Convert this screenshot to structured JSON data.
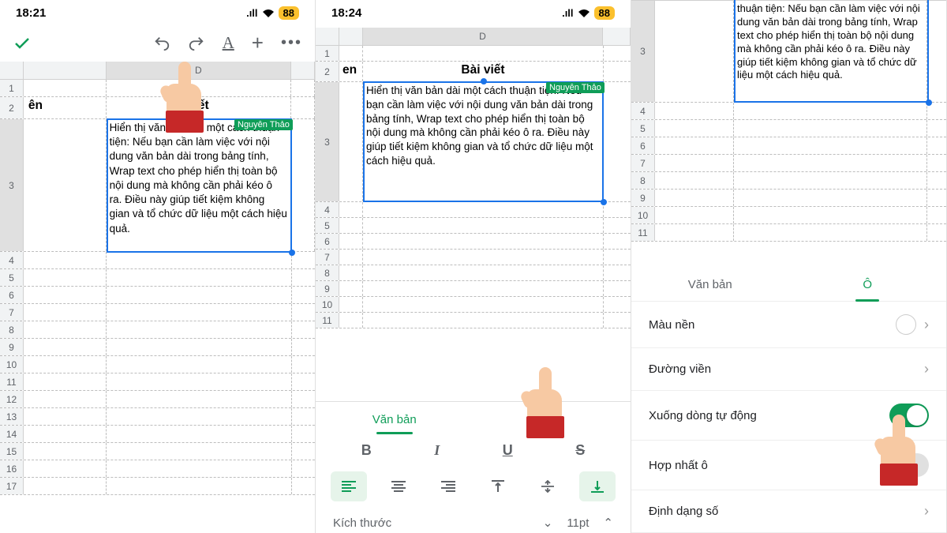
{
  "status": {
    "time1": "18:21",
    "time2": "18:24",
    "battery": "88",
    "signal": "••ıl",
    "wifi": "✓"
  },
  "toolbar": {
    "confirm": "✓",
    "undo": "↶",
    "redo": "↷",
    "format": "A",
    "add": "+",
    "more": "•••"
  },
  "sheet": {
    "columns": [
      "D"
    ],
    "row2_left": "ên",
    "row2_left_b": "en",
    "row2_title_a": "viết",
    "row2_title": "Bài viết",
    "cell_text_a": "Hiển thị\nthuận tiện: Nếu bạn cần làm việc với nội dung văn bản dài trong bảng tính, Wrap text cho phép hiển thị toàn bộ nội dung mà không cần phải kéo ô ra. Điều này giúp tiết kiệm không gian và tổ chức dữ liệu một cách hiệu quả.",
    "cell_text_a_frag": "ản dài mộ",
    "cell_text": "Hiển thị văn bản dài một cách thuận tiện: Nếu bạn cần làm việc với nội dung văn bản dài trong bảng tính, Wrap text cho phép hiển thị toàn bộ nội dung mà không cần phải kéo ô ra. Điều này giúp tiết kiệm không gian và tổ chức dữ liệu một cách hiệu quả.",
    "cell_text_c": "thuận tiện: Nếu bạn cần làm việc với nội dung văn bản dài trong bảng tính, Wrap text cho phép hiển thị toàn bộ nội dung mà không cần phải kéo ô ra. Điều này giúp tiết kiệm không gian và tổ chức dữ liệu một cách hiệu quả.",
    "tag": "Nguyên Thảo"
  },
  "format": {
    "tab_text": "Văn bản",
    "tab_cell": "Ô",
    "bold": "B",
    "italic": "I",
    "underline": "U",
    "strike": "S",
    "size_label": "Kích thước",
    "size_value": "11pt"
  },
  "cellopts": {
    "tab_text": "Văn bản",
    "tab_cell": "Ô",
    "bgcolor": "Màu nền",
    "border": "Đường viền",
    "wrap": "Xuống dòng tự động",
    "merge": "Hợp nhất ô",
    "numfmt": "Định dạng số"
  }
}
